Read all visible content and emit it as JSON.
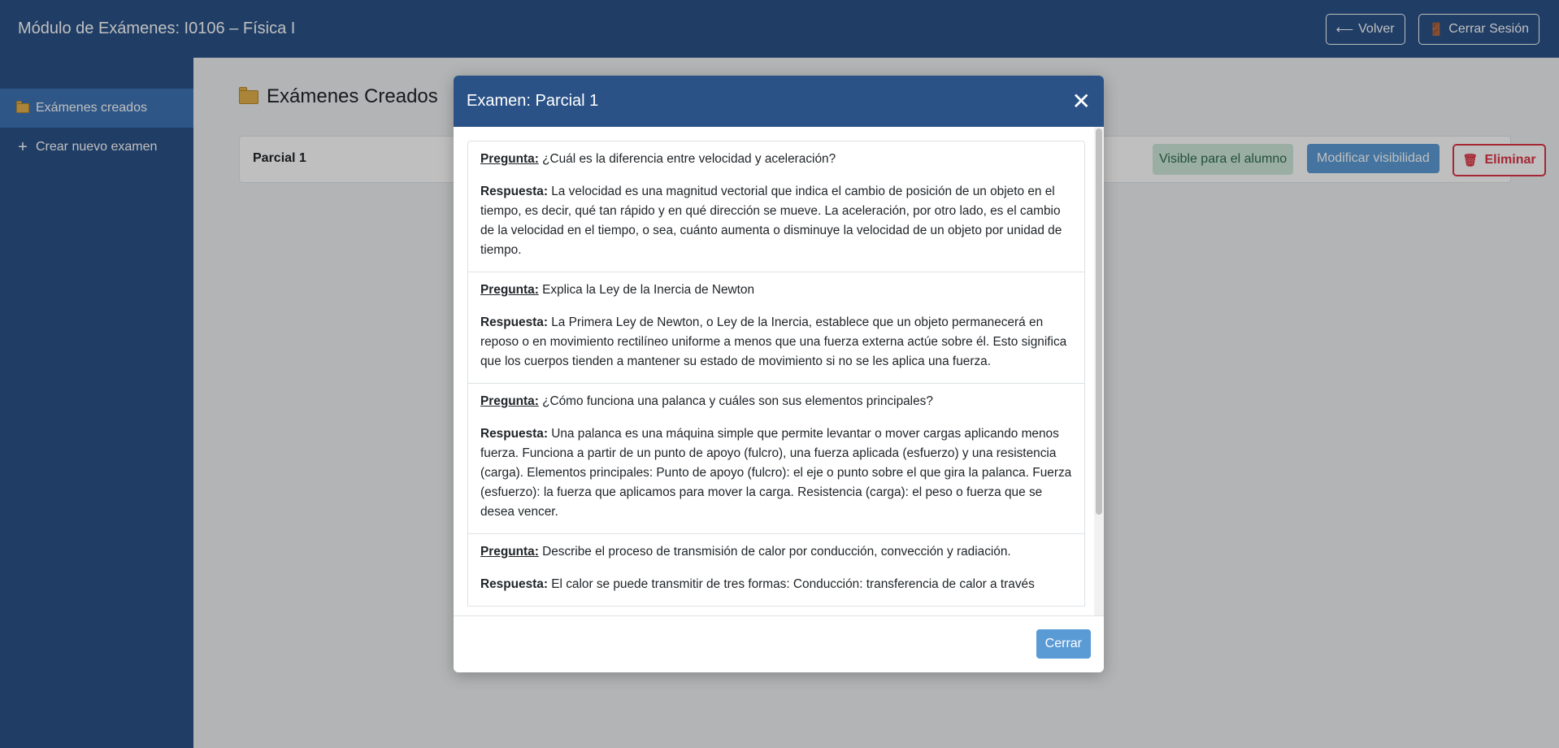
{
  "header": {
    "title": "Módulo de Exámenes: I0106 – Física I",
    "back_label": "Volver",
    "back_icon": "arrow-left-icon",
    "logout_label": "Cerrar Sesión",
    "logout_icon": "door-icon"
  },
  "sidebar": {
    "items": [
      {
        "label": "Exámenes creados",
        "icon": "folder-icon",
        "active": true
      },
      {
        "label": "Crear nuevo examen",
        "icon": "plus-icon",
        "active": false
      }
    ]
  },
  "main": {
    "section_title": "Exámenes Creados",
    "exams": [
      {
        "name": "Parcial 1",
        "visibility_badge": "Visible para el alumno",
        "modify_label": "Modificar visibilidad",
        "delete_label": "Eliminar"
      }
    ]
  },
  "modal": {
    "title": "Examen: Parcial 1",
    "question_label": "Pregunta:",
    "answer_label": "Respuesta:",
    "items": [
      {
        "question": "¿Cuál es la diferencia entre velocidad y aceleración?",
        "answer": "La velocidad es una magnitud vectorial que indica el cambio de posición de un objeto en el tiempo, es decir, qué tan rápido y en qué dirección se mueve. La aceleración, por otro lado, es el cambio de la velocidad en el tiempo, o sea, cuánto aumenta o disminuye la velocidad de un objeto por unidad de tiempo."
      },
      {
        "question": "Explica la Ley de la Inercia de Newton",
        "answer": "La Primera Ley de Newton, o Ley de la Inercia, establece que un objeto permanecerá en reposo o en movimiento rectilíneo uniforme a menos que una fuerza externa actúe sobre él. Esto significa que los cuerpos tienden a mantener su estado de movimiento si no se les aplica una fuerza."
      },
      {
        "question": "¿Cómo funciona una palanca y cuáles son sus elementos principales?",
        "answer": "Una palanca es una máquina simple que permite levantar o mover cargas aplicando menos fuerza. Funciona a partir de un punto de apoyo (fulcro), una fuerza aplicada (esfuerzo) y una resistencia (carga). Elementos principales: Punto de apoyo (fulcro): el eje o punto sobre el que gira la palanca. Fuerza (esfuerzo): la fuerza que aplicamos para mover la carga. Resistencia (carga): el peso o fuerza que se desea vencer."
      },
      {
        "question": "Describe el proceso de transmisión de calor por conducción, convección y radiación.",
        "answer": "El calor se puede transmitir de tres formas: Conducción: transferencia de calor a través"
      }
    ],
    "close_label": "Cerrar"
  },
  "colors": {
    "primary": "#2a5287",
    "sidebar_active": "#3e73b4",
    "info_button": "#5b9bd5",
    "success_badge_bg": "#cfe9db",
    "danger": "#dc3545"
  }
}
